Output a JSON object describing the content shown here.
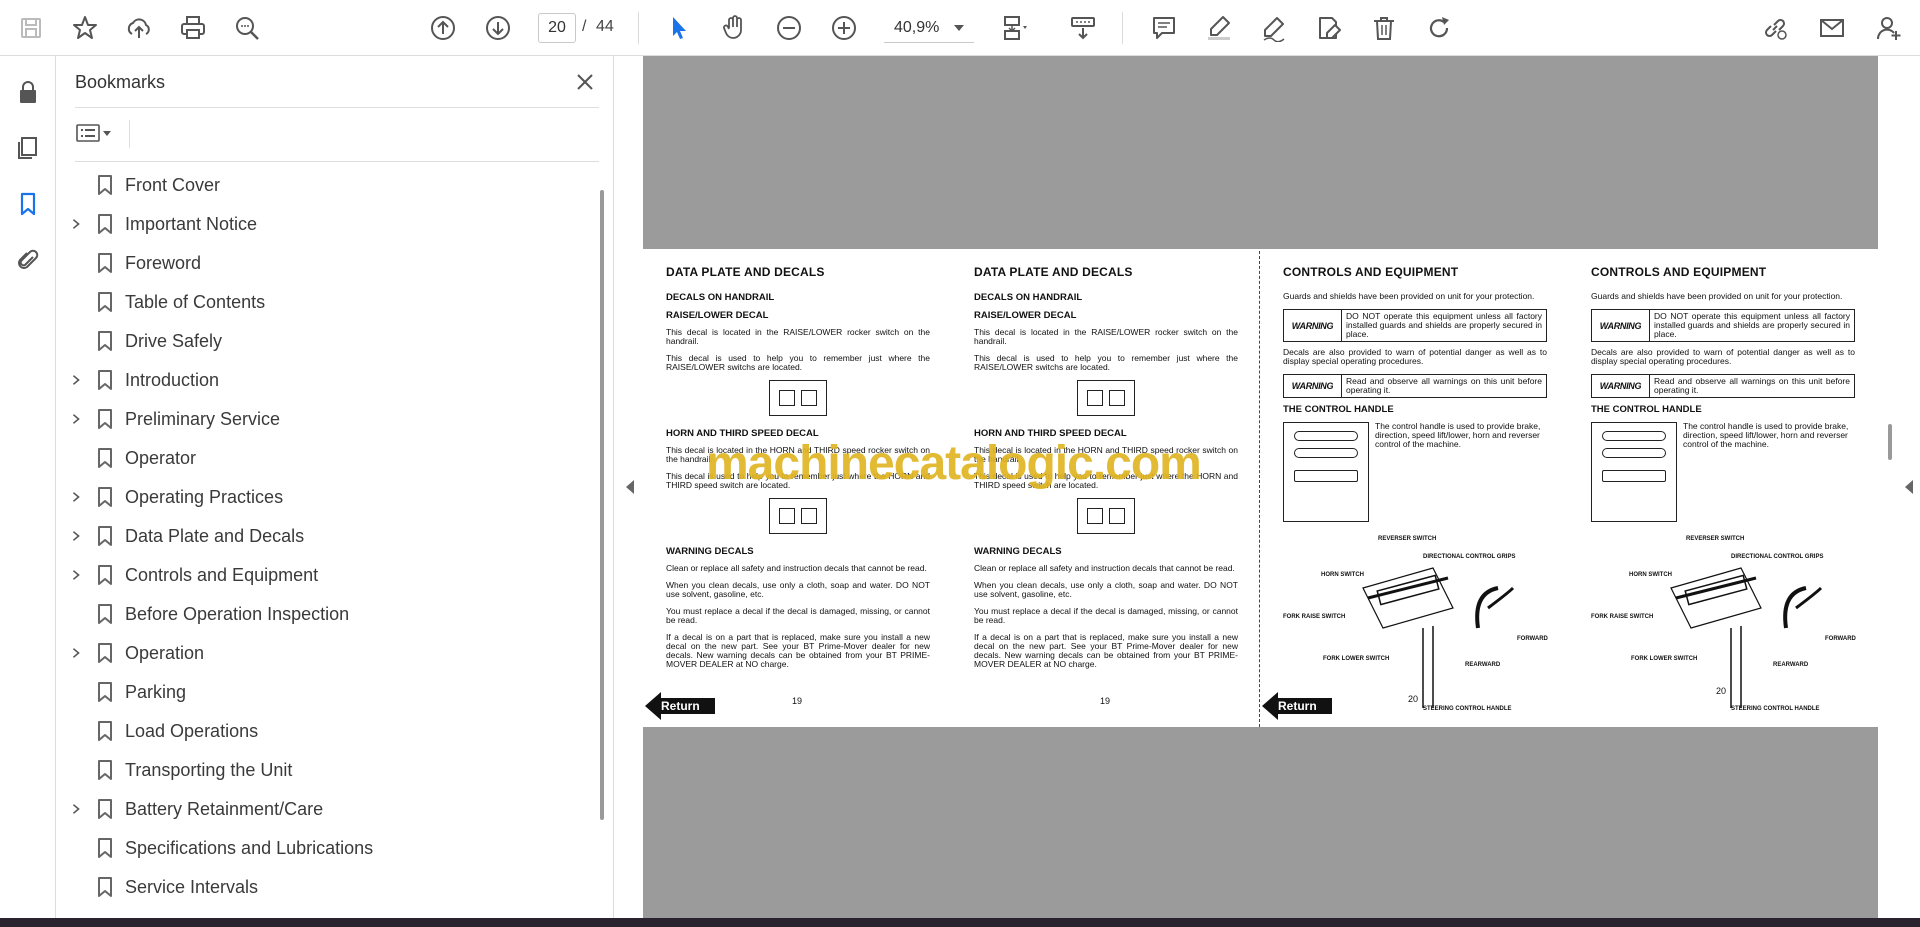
{
  "toolbar": {
    "icons": [
      "save-icon",
      "star-icon",
      "upload-icon",
      "print-icon",
      "zoom-find-icon",
      "page-up-icon",
      "page-down-icon",
      "select-pointer-icon",
      "hand-icon",
      "zoom-out-icon",
      "zoom-in-icon",
      "fit-page-icon",
      "scroll-mode-icon",
      "comment-icon",
      "highlight-icon",
      "sign-icon",
      "fill-sign-icon",
      "delete-icon",
      "rotate-icon",
      "share-link-icon",
      "email-icon",
      "add-user-icon"
    ],
    "current_page": "20",
    "page_separator": "/",
    "total_pages": "44",
    "zoom": "40,9%"
  },
  "rail": {
    "icons": [
      "lock-icon",
      "pages-icon",
      "bookmark-icon",
      "attachment-icon"
    ]
  },
  "bookmarks": {
    "title": "Bookmarks",
    "items": [
      {
        "label": "Front Cover",
        "expandable": false
      },
      {
        "label": "Important Notice",
        "expandable": true
      },
      {
        "label": "Foreword",
        "expandable": false
      },
      {
        "label": "Table of Contents",
        "expandable": false
      },
      {
        "label": "Drive Safely",
        "expandable": false
      },
      {
        "label": "Introduction",
        "expandable": true
      },
      {
        "label": "Preliminary Service",
        "expandable": true
      },
      {
        "label": "Operator",
        "expandable": false
      },
      {
        "label": "Operating Practices",
        "expandable": true
      },
      {
        "label": "Data Plate and Decals",
        "expandable": true
      },
      {
        "label": "Controls and Equipment",
        "expandable": true
      },
      {
        "label": "Before Operation Inspection",
        "expandable": false
      },
      {
        "label": "Operation",
        "expandable": true
      },
      {
        "label": "Parking",
        "expandable": false
      },
      {
        "label": "Load Operations",
        "expandable": false
      },
      {
        "label": "Transporting the Unit",
        "expandable": false
      },
      {
        "label": "Battery Retainment/Care",
        "expandable": true
      },
      {
        "label": "Specifications and Lubrications",
        "expandable": false
      },
      {
        "label": "Service Intervals",
        "expandable": false
      }
    ]
  },
  "document": {
    "watermark": "machinecatalogic.com",
    "return_label": "Return",
    "decals_page": {
      "title": "DATA PLATE AND DECALS",
      "sub_handrail": "DECALS ON HANDRAIL",
      "sub_raise": "RAISE/LOWER DECAL",
      "p1": "This decal is located in the RAISE/LOWER rocker switch on the handrail.",
      "p2": "This decal is used to help you to remember just where the RAISE/LOWER switchs are located.",
      "sub_horn": "HORN AND THIRD SPEED DECAL",
      "p3": "This decal is located in the HORN and THIRD speed rocker switch on the handrail.",
      "p4": "This decal is used to help you to remember just where the HORN and THIRD speed switch are located.",
      "sub_warning": "WARNING DECALS",
      "p5": "Clean or replace all safety and instruction decals that cannot be read.",
      "p6": "When you clean decals, use only a cloth, soap and water. DO NOT use solvent, gasoline, etc.",
      "p7": "You must replace a decal if the decal is damaged, missing, or cannot be read.",
      "p8": "If a decal is on a part that is replaced, make sure you install a new decal on the new part. See your BT Prime-Mover dealer for new decals. New warning decals can be obtained from your BT PRIME-MOVER DEALER at NO charge.",
      "page_number": "19"
    },
    "controls_page": {
      "title": "CONTROLS AND EQUIPMENT",
      "p1": "Guards and shields have been provided on unit for your protection.",
      "warn_tag": "WARNING",
      "warn1": "DO NOT operate this equipment unless all factory installed guards and shields are properly secured in place.",
      "p2": "Decals are also provided to warn of potential danger as well as to display special operating procedures.",
      "warn2": "Read and observe all warnings on this unit before operating it.",
      "sub_handle": "THE CONTROL HANDLE",
      "p3": "The control handle is used to provide brake, direction, speed lift/lower, horn and reverser control of the machine.",
      "labels": {
        "reverser": "REVERSER SWITCH",
        "grips": "DIRECTIONAL CONTROL GRIPS",
        "horn": "HORN SWITCH",
        "fork_raise": "FORK RAISE SWITCH",
        "forward": "FORWARD",
        "fork_lower": "FORK LOWER SWITCH",
        "rearward": "REARWARD",
        "steering": "STEERING CONTROL HANDLE"
      },
      "page_number": "20"
    }
  }
}
